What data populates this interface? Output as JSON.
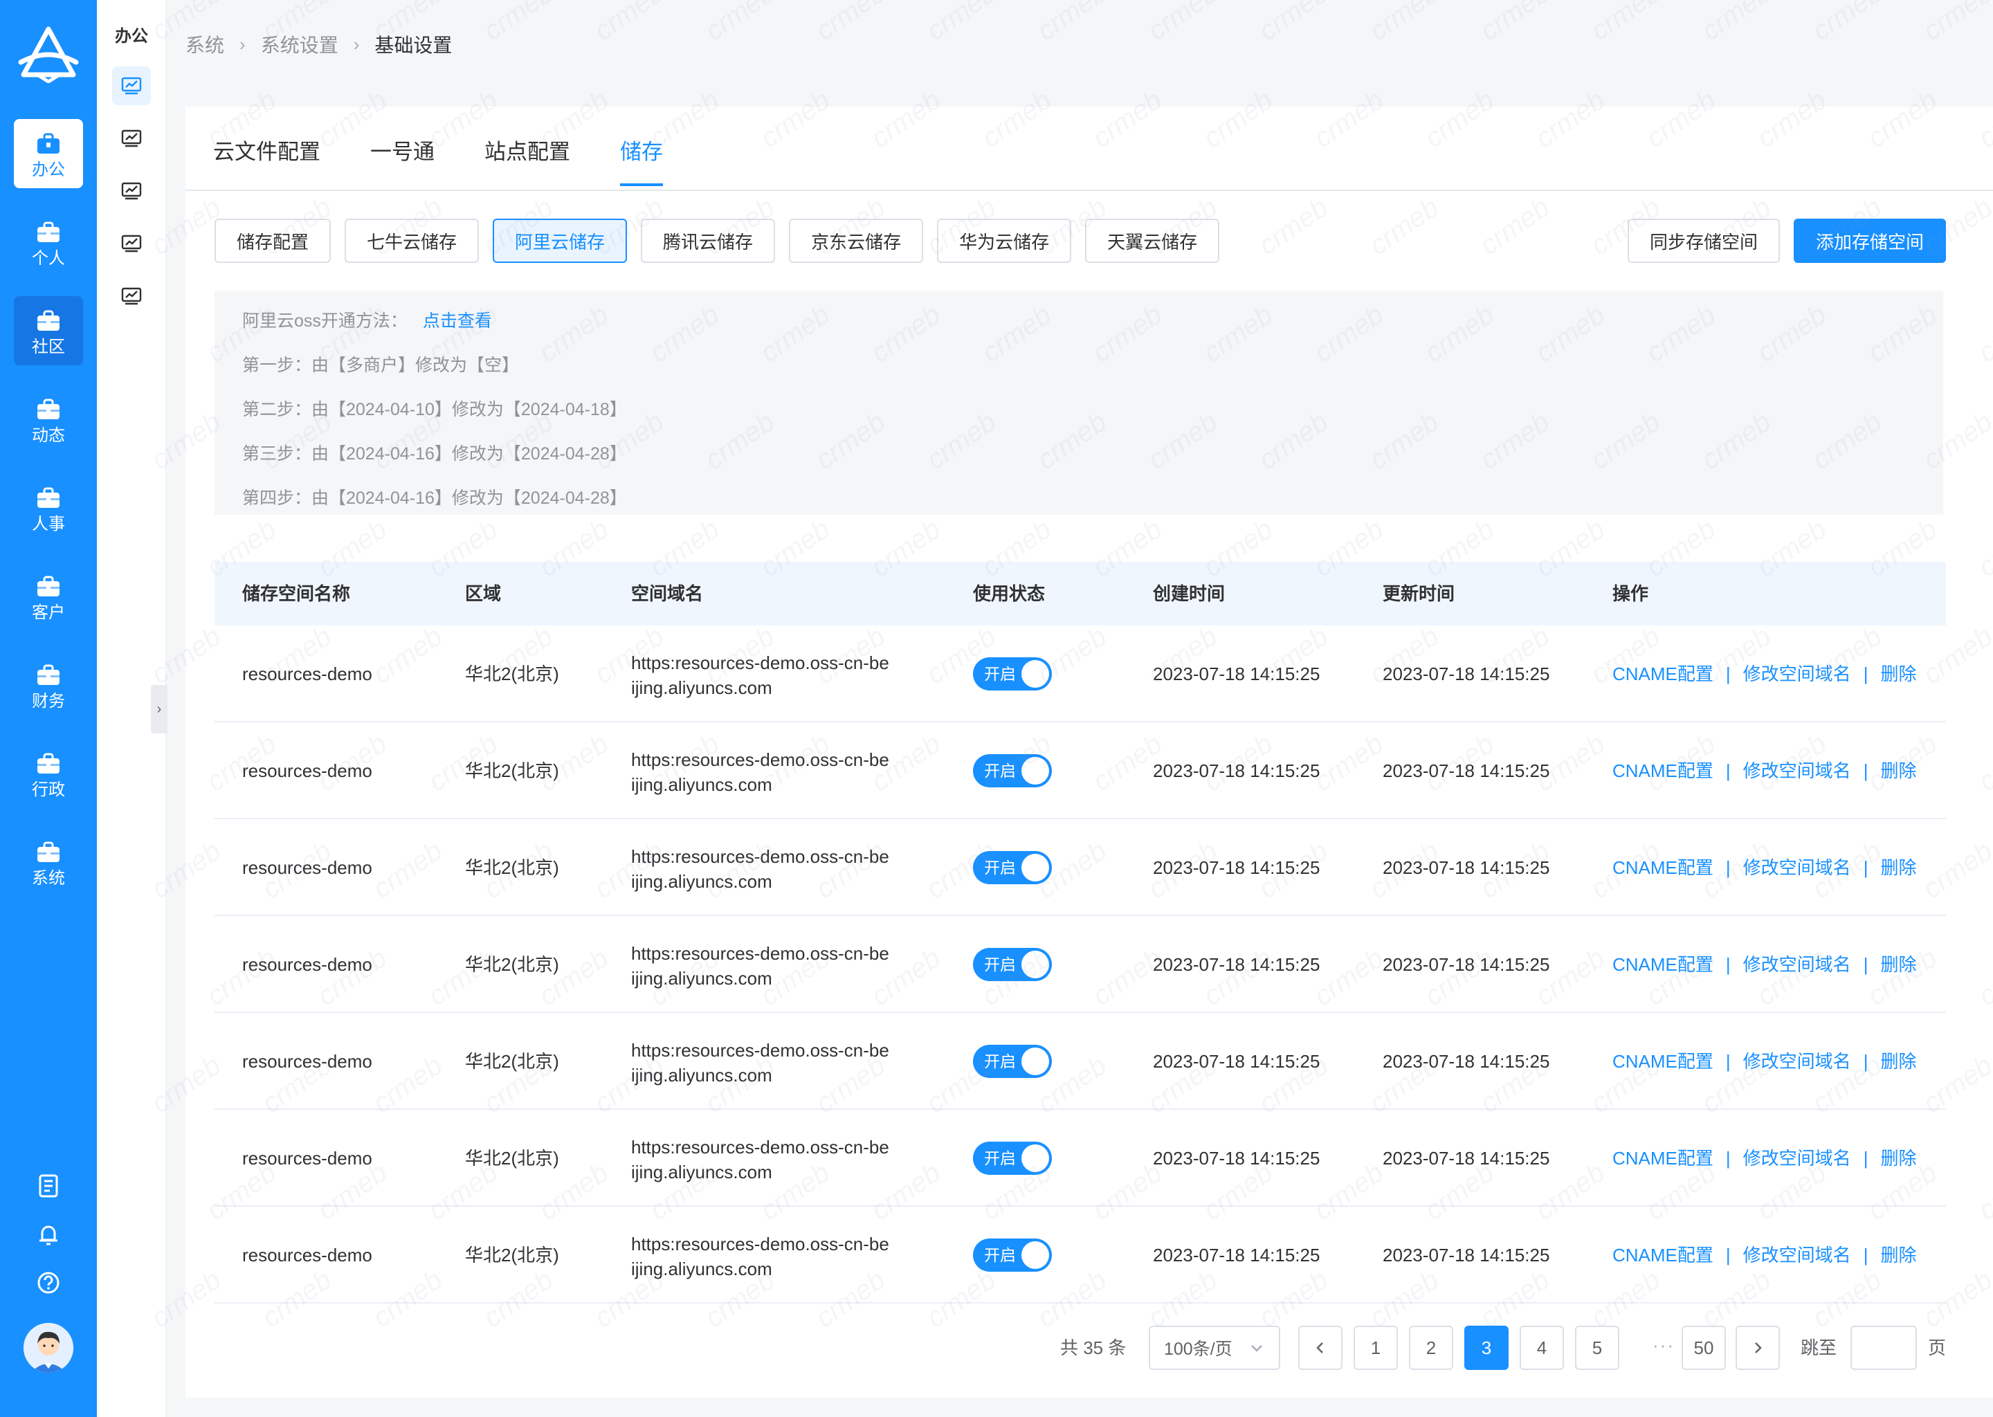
{
  "sidebar": {
    "items": [
      {
        "label": "办公",
        "state": "active"
      },
      {
        "label": "个人",
        "state": "normal"
      },
      {
        "label": "社区",
        "state": "dim"
      },
      {
        "label": "动态",
        "state": "normal"
      },
      {
        "label": "人事",
        "state": "normal"
      },
      {
        "label": "客户",
        "state": "normal"
      },
      {
        "label": "财务",
        "state": "normal"
      },
      {
        "label": "行政",
        "state": "normal"
      },
      {
        "label": "系统",
        "state": "normal"
      }
    ],
    "bottom_icons": [
      "log-icon",
      "bell-icon",
      "help-icon"
    ]
  },
  "subnav": {
    "title": "办公",
    "icons": [
      "chart-screen-icon",
      "chart-screen-icon",
      "chart-screen-icon",
      "chart-screen-icon",
      "chart-screen-icon"
    ]
  },
  "breadcrumb": {
    "items": [
      "系统",
      "系统设置",
      "基础设置"
    ]
  },
  "tabs": [
    "云文件配置",
    "一号通",
    "站点配置",
    "储存"
  ],
  "active_tab": "储存",
  "subtabs": [
    "储存配置",
    "七牛云储存",
    "阿里云储存",
    "腾讯云储存",
    "京东云储存",
    "华为云储存",
    "天翼云储存"
  ],
  "active_subtab": "阿里云储存",
  "actions": {
    "sync": "同步存储空间",
    "add": "添加存储空间"
  },
  "tips": {
    "intro": "阿里云oss开通方法：",
    "link": "点击查看",
    "steps": [
      "第一步：由【多商户】修改为【空】",
      "第二步：由【2024-04-10】修改为【2024-04-18】",
      "第三步：由【2024-04-16】修改为【2024-04-28】",
      "第四步：由【2024-04-16】修改为【2024-04-28】"
    ]
  },
  "table": {
    "columns": [
      "储存空间名称",
      "区域",
      "空间域名",
      "使用状态",
      "创建时间",
      "更新时间",
      "操作"
    ],
    "rows": [
      {
        "name": "resources-demo",
        "region": "华北2(北京)",
        "domain_1": "https:resources-demo.oss-cn-be",
        "domain_2": "ijing.aliyuncs.com",
        "status": "开启",
        "created": "2023-07-18 14:15:25",
        "updated": "2023-07-18 14:15:25"
      },
      {
        "name": "resources-demo",
        "region": "华北2(北京)",
        "domain_1": "https:resources-demo.oss-cn-be",
        "domain_2": "ijing.aliyuncs.com",
        "status": "开启",
        "created": "2023-07-18 14:15:25",
        "updated": "2023-07-18 14:15:25"
      },
      {
        "name": "resources-demo",
        "region": "华北2(北京)",
        "domain_1": "https:resources-demo.oss-cn-be",
        "domain_2": "ijing.aliyuncs.com",
        "status": "开启",
        "created": "2023-07-18 14:15:25",
        "updated": "2023-07-18 14:15:25"
      },
      {
        "name": "resources-demo",
        "region": "华北2(北京)",
        "domain_1": "https:resources-demo.oss-cn-be",
        "domain_2": "ijing.aliyuncs.com",
        "status": "开启",
        "created": "2023-07-18 14:15:25",
        "updated": "2023-07-18 14:15:25"
      },
      {
        "name": "resources-demo",
        "region": "华北2(北京)",
        "domain_1": "https:resources-demo.oss-cn-be",
        "domain_2": "ijing.aliyuncs.com",
        "status": "开启",
        "created": "2023-07-18 14:15:25",
        "updated": "2023-07-18 14:15:25"
      },
      {
        "name": "resources-demo",
        "region": "华北2(北京)",
        "domain_1": "https:resources-demo.oss-cn-be",
        "domain_2": "ijing.aliyuncs.com",
        "status": "开启",
        "created": "2023-07-18 14:15:25",
        "updated": "2023-07-18 14:15:25"
      },
      {
        "name": "resources-demo",
        "region": "华北2(北京)",
        "domain_1": "https:resources-demo.oss-cn-be",
        "domain_2": "ijing.aliyuncs.com",
        "status": "开启",
        "created": "2023-07-18 14:15:25",
        "updated": "2023-07-18 14:15:25"
      }
    ],
    "ops": [
      "CNAME配置",
      "修改空间域名",
      "删除"
    ]
  },
  "pagination": {
    "total": "共 35 条",
    "page_size": "100条/页",
    "pages": [
      "1",
      "2",
      "3",
      "4",
      "5"
    ],
    "current": "3",
    "ellipsis": "···",
    "last": "50",
    "jump_label": "跳至",
    "jump_unit": "页"
  },
  "watermark_text": "crmeb",
  "colors": {
    "primary": "#1890ff",
    "sidebar": "#1890ff",
    "tips_bg": "#f5f6f8",
    "thead_bg": "#f0f6fe"
  }
}
